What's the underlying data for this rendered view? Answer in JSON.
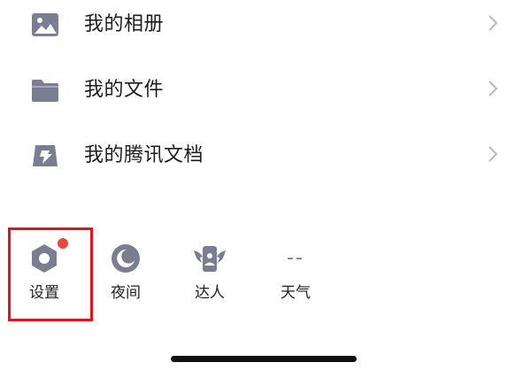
{
  "menu": {
    "items": [
      {
        "label": "我的相册",
        "icon": "photo-album-icon"
      },
      {
        "label": "我的文件",
        "icon": "folder-icon"
      },
      {
        "label": "我的腾讯文档",
        "icon": "tencent-docs-icon"
      }
    ]
  },
  "toolbar": {
    "items": [
      {
        "label": "设置",
        "icon": "settings-icon",
        "badge": true,
        "highlighted": true
      },
      {
        "label": "夜间",
        "icon": "night-mode-icon"
      },
      {
        "label": "达人",
        "icon": "talent-icon"
      },
      {
        "label": "天气",
        "icon": "weather-icon",
        "icon_text": "--"
      }
    ]
  },
  "colors": {
    "icon": "#7b7d92",
    "highlight_border": "#e0141c",
    "badge": "#e8493d",
    "chevron": "#b8b8b8"
  }
}
